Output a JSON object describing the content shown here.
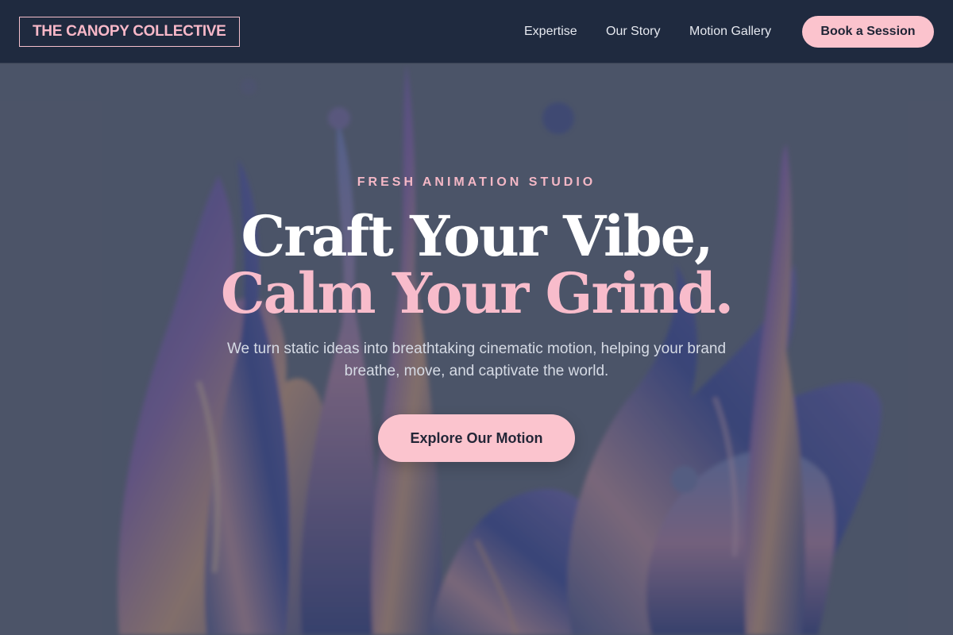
{
  "header": {
    "logo_text": "THE CANOPY COLLECTIVE",
    "nav": {
      "expertise": "Expertise",
      "story": "Our Story",
      "gallery": "Motion Gallery"
    },
    "cta_label": "Book a Session"
  },
  "hero": {
    "eyebrow": "FRESH ANIMATION STUDIO",
    "headline_line1": "Craft Your Vibe,",
    "headline_line2": "Calm Your Grind.",
    "subtext": "We turn static ideas into breathtaking cinematic motion, helping your brand breathe, move, and captivate the world.",
    "cta_label": "Explore Our Motion"
  },
  "colors": {
    "header_bg": "#1f2a3f",
    "accent_pink": "#fbc3cd",
    "hero_overlay": "#40485c"
  }
}
